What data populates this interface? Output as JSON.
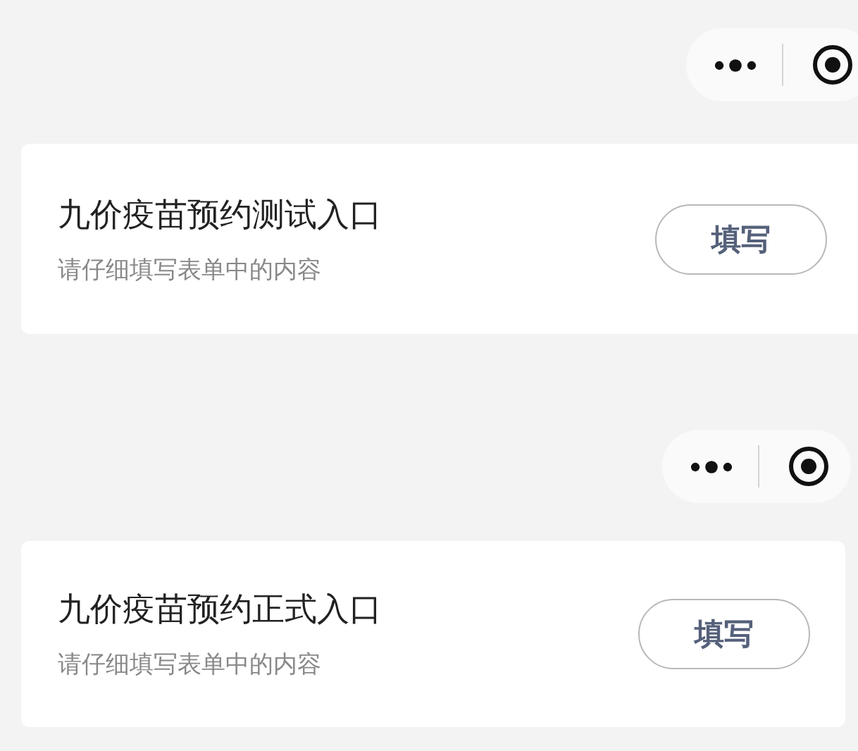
{
  "sections": [
    {
      "card": {
        "title": "九价疫苗预约测试入口",
        "subtitle": "请仔细填写表单中的内容",
        "button": "填写"
      }
    },
    {
      "card": {
        "title": "九价疫苗预约正式入口",
        "subtitle": "请仔细填写表单中的内容",
        "button": "填写"
      }
    }
  ]
}
